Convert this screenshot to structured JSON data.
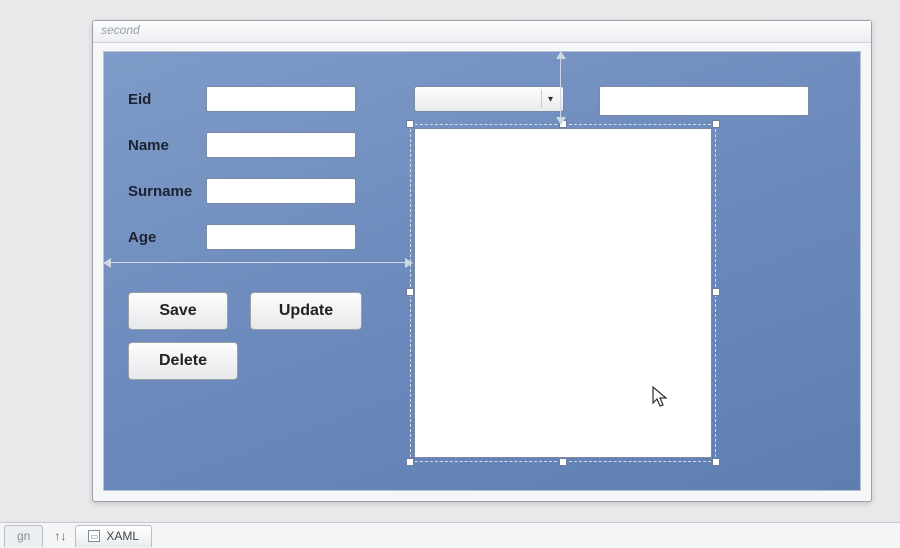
{
  "window": {
    "title": "second"
  },
  "form": {
    "eid_label": "Eid",
    "name_label": "Name",
    "surname_label": "Surname",
    "age_label": "Age",
    "eid_value": "",
    "name_value": "",
    "surname_value": "",
    "age_value": ""
  },
  "combo": {
    "selected": ""
  },
  "right_textbox": {
    "value": ""
  },
  "buttons": {
    "save": "Save",
    "update": "Update",
    "delete": "Delete"
  },
  "tabs": {
    "design": "gn",
    "swap_icon": "↑↓",
    "xaml": "XAML"
  }
}
